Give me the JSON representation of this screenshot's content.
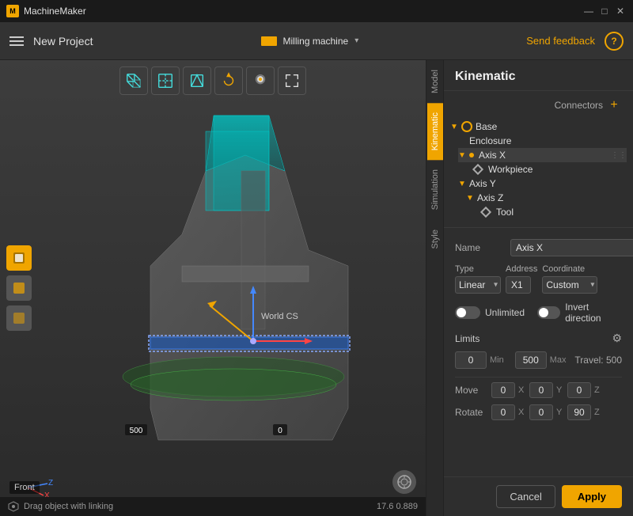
{
  "titlebar": {
    "app_name": "MachineMaker",
    "min_btn": "—",
    "max_btn": "□",
    "close_btn": "✕"
  },
  "topbar": {
    "menu_label": "Menu",
    "project_name": "New Project",
    "machine_label": "Milling machine",
    "send_feedback": "Send feedback",
    "help_label": "?"
  },
  "viewport": {
    "world_cs_label": "World CS",
    "dim_500": "500",
    "dim_0": "0",
    "view_label": "Front",
    "status_text": "Drag object with linking",
    "status_coords": "17.6  0.889"
  },
  "viewport_toolbar": {
    "tools": [
      {
        "name": "perspective-view-icon",
        "label": "Perspective View"
      },
      {
        "name": "top-view-icon",
        "label": "Top View"
      },
      {
        "name": "front-view-icon",
        "label": "Front View"
      },
      {
        "name": "rotate-icon",
        "label": "Rotate"
      },
      {
        "name": "light-icon",
        "label": "Lighting"
      },
      {
        "name": "expand-icon",
        "label": "Expand"
      }
    ]
  },
  "side_tabs": [
    {
      "id": "model",
      "label": "Model",
      "active": false
    },
    {
      "id": "kinematic",
      "label": "Kinematic",
      "active": true
    },
    {
      "id": "simulation",
      "label": "Simulation",
      "active": false
    },
    {
      "id": "style",
      "label": "Style",
      "active": false
    }
  ],
  "right_panel": {
    "title": "Kinematic",
    "connectors_label": "Connectors",
    "connectors_add": "+",
    "tree": {
      "base_label": "Base",
      "enclosure_label": "Enclosure",
      "axis_x_label": "Axis X",
      "workpiece_label": "Workpiece",
      "axis_y_label": "Axis Y",
      "axis_z_label": "Axis Z",
      "tool_label": "Tool"
    },
    "properties": {
      "name_label": "Name",
      "name_value": "Axis X",
      "name_more": "...",
      "type_label": "Type",
      "type_value": "Linear",
      "address_label": "Address",
      "address_value": "X1",
      "coordinate_label": "Coordinate",
      "coordinate_value": "Custom",
      "unlimited_label": "Unlimited",
      "invert_label": "Invert direction",
      "limits_label": "Limits",
      "limit_min": "0",
      "limit_min_unit": "Min",
      "limit_max": "500",
      "limit_max_unit": "Max",
      "travel_label": "Travel: 500",
      "move_label": "Move",
      "move_x": "0",
      "move_x_axis": "X",
      "move_y": "0",
      "move_y_axis": "Y",
      "move_z": "0",
      "move_z_axis": "Z",
      "rotate_label": "Rotate",
      "rotate_x": "0",
      "rotate_x_axis": "X",
      "rotate_y": "0",
      "rotate_y_axis": "Y",
      "rotate_z": "90",
      "rotate_z_axis": "Z"
    },
    "footer": {
      "cancel_label": "Cancel",
      "apply_label": "Apply"
    }
  }
}
